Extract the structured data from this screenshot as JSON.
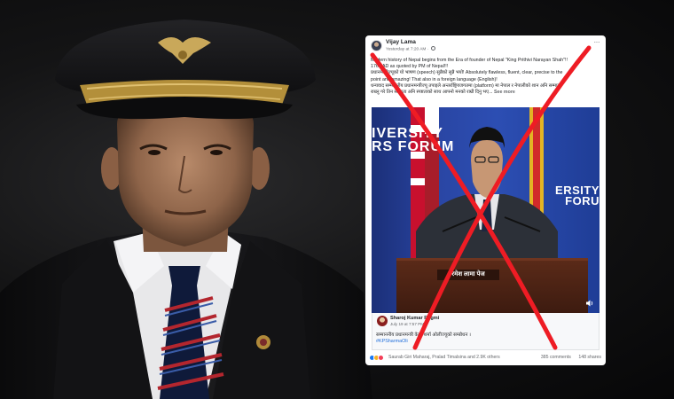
{
  "post": {
    "author": "Vijay Lama",
    "time": "Yesterday at 7:20 AM",
    "text_lines": [
      "Modern history of Nepal begins from the Era of  founder of Nepal \"King Prithivi Narayan Shah\"!!",
      "1768 AD as quoted by PM of Nepal!!!",
      "प्रधानमन्त्रीज्यूको यो भाषण (speech) सुन्नैको सुन्नै भयो! Absolutely flawless, fluent, clear, precise to the",
      "point and amazing! That also in a foreign language (English)!",
      "धन्यवाद सम्माननीय प्रधानमन्त्रीज्यू तपाइले अन्तर्राष्ट्रियजगतमा (platform) मा नेपाल र नेपालीको शान अनि सम्मान",
      "राख्नु गरे तिन सरलता अनि स्पष्टताको साथ आफ्नो मनको राम्री दिनु भए..."
    ],
    "see_more": "See more"
  },
  "video": {
    "banner_left": "IVERSITY\nRS FORUM",
    "banner_right": "ERSITY\nFORU",
    "podium_label": "रमेश लामा पेज"
  },
  "shared": {
    "author": "Sharoj Kumar Regmi",
    "time": "July 19 at 7:57 PM",
    "text": "सम्माननीय प्रधानमन्त्री केपी शर्मा ओलीज्यूको सम्बोधन ।",
    "hashtag": "#KPSharmaOli"
  },
  "reactions": {
    "names": "Saurab Giri Maharaj, Pralad Timalsina and 2.9K others",
    "comments": "385 comments",
    "shares": "148 shares"
  },
  "colors": {
    "cross": "#ee1c24",
    "fb_blue": "#1877f2"
  }
}
